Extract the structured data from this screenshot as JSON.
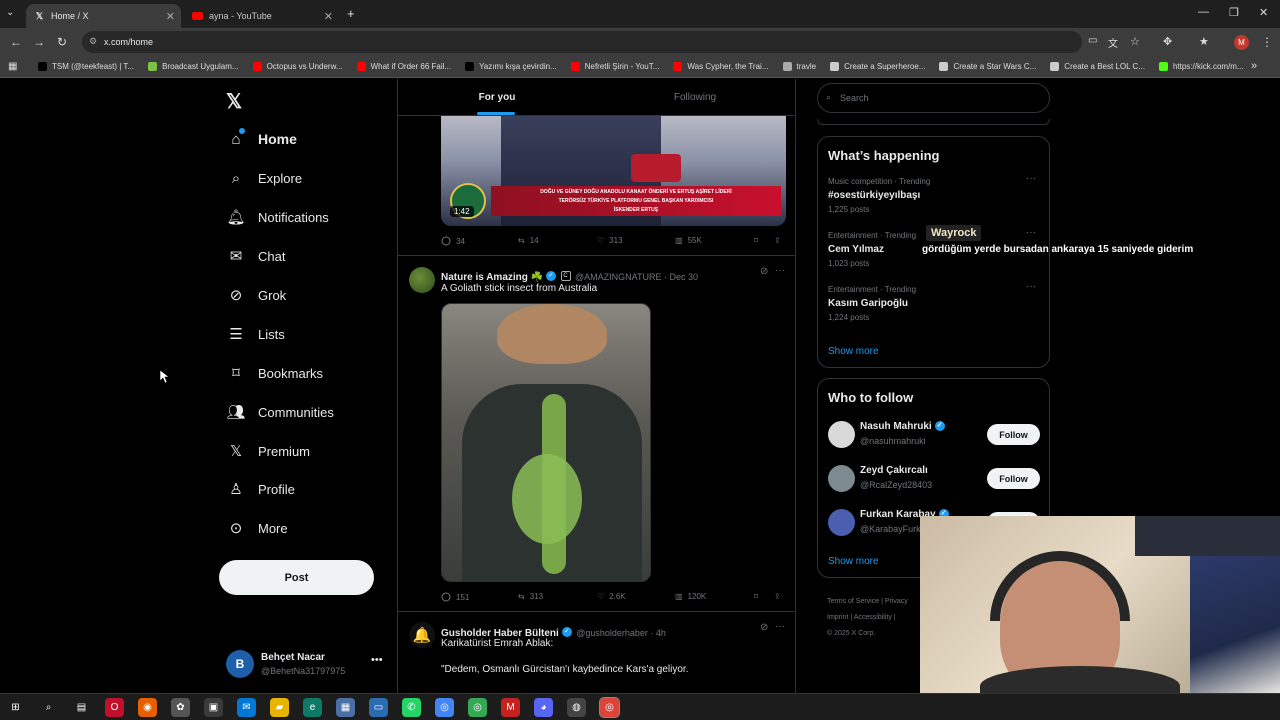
{
  "browser": {
    "tabs": [
      {
        "title": "Home / X",
        "favicon": "x-logo-icon"
      },
      {
        "title": "ayna - YouTube",
        "favicon": "youtube-icon"
      }
    ],
    "url": "x.com/home",
    "bookmarks": [
      {
        "label": "TSM (@teekfeast) | T...",
        "icon": "tiktok-icon",
        "color": "#000000"
      },
      {
        "label": "Broadcast Uygulam...",
        "icon": "leaf-icon",
        "color": "#7cc242"
      },
      {
        "label": "Octopus vs Underw...",
        "icon": "youtube-icon",
        "color": "#ff0000"
      },
      {
        "label": "What if Order 66 Fail...",
        "icon": "youtube-icon",
        "color": "#ff0000"
      },
      {
        "label": "Yazımı kışa çevirdin...",
        "icon": "tiktok-icon",
        "color": "#000000"
      },
      {
        "label": "Nefretli Şirin - YouT...",
        "icon": "youtube-icon",
        "color": "#ff0000"
      },
      {
        "label": "Was Cypher, the Trai...",
        "icon": "youtube-icon",
        "color": "#ff0000"
      },
      {
        "label": "travle",
        "icon": "compass-icon",
        "color": "#aaaaaa"
      },
      {
        "label": "Create a Superheroe...",
        "icon": "doc-icon",
        "color": "#cccccc"
      },
      {
        "label": "Create a Star Wars C...",
        "icon": "doc-icon",
        "color": "#cccccc"
      },
      {
        "label": "Create a Best LOL C...",
        "icon": "doc-icon",
        "color": "#cccccc"
      },
      {
        "label": "https://kick.com/m...",
        "icon": "kick-icon",
        "color": "#53fc18"
      }
    ],
    "profile_initial": "M"
  },
  "sidebar": {
    "items": [
      {
        "label": "Home",
        "icon": "home-icon"
      },
      {
        "label": "Explore",
        "icon": "search-icon"
      },
      {
        "label": "Notifications",
        "icon": "bell-icon"
      },
      {
        "label": "Chat",
        "icon": "mail-icon"
      },
      {
        "label": "Grok",
        "icon": "grok-icon"
      },
      {
        "label": "Lists",
        "icon": "list-icon"
      },
      {
        "label": "Bookmarks",
        "icon": "bookmark-icon"
      },
      {
        "label": "Communities",
        "icon": "people-icon"
      },
      {
        "label": "Premium",
        "icon": "x-logo-icon"
      },
      {
        "label": "Profile",
        "icon": "person-icon"
      },
      {
        "label": "More",
        "icon": "more-circle-icon"
      }
    ],
    "post_label": "Post",
    "account": {
      "initial": "B",
      "name": "Behçet Nacar",
      "handle": "@BehetNa31797975"
    }
  },
  "feed": {
    "tabs": [
      "For you",
      "Following"
    ],
    "video_post": {
      "video_duration": "1:42",
      "banner_line1": "DOĞU VE GÜNEY DOĞU ANADOLU KANAAT ÖNDERİ VE ERTUŞ AŞİRET LİDERİ",
      "banner_line2": "TERÖRSÜZ TÜRKİYE PLATFORMU GENEL BAŞKAN YARDIMCISI",
      "banner_line3": "İSKENDER ERTUŞ",
      "stats": {
        "replies": "34",
        "reposts": "14",
        "likes": "313",
        "views": "55K"
      }
    },
    "post2": {
      "name": "Nature is Amazing ☘️",
      "handle": "@AMAZINGNATURE · Dec 30",
      "text": "A Goliath stick insect from Australia",
      "stats": {
        "replies": "151",
        "reposts": "313",
        "likes": "2.6K",
        "views": "120K"
      }
    },
    "post3": {
      "name": "Gusholder Haber Bülteni",
      "handle": "@gusholderhaber · 4h",
      "line1": "Karikatürist Emrah Ablak:",
      "line2": "\"Dedem, Osmanlı Gürcistan'ı kaybedince Kars'a geliyor."
    }
  },
  "right": {
    "search_placeholder": "Search",
    "happening": {
      "title": "What’s happening",
      "trends": [
        {
          "category": "Music competition · Trending",
          "name": "#osestürkiyeyılbaşı",
          "posts": "1,225 posts"
        },
        {
          "category": "Entertainment · Trending",
          "name": "Cem Yılmaz",
          "posts": "1,023 posts"
        },
        {
          "category": "Entertainment · Trending",
          "name": "Kasım Garipoğlu",
          "posts": "1,224 posts"
        }
      ],
      "show_more": "Show more"
    },
    "who_to_follow": {
      "title": "Who to follow",
      "users": [
        {
          "name": "Nasuh Mahruki",
          "handle": "@nasuhmahruki",
          "verified": true
        },
        {
          "name": "Zeyd Çakırcalı",
          "handle": "@RcalZeyd28403",
          "verified": false
        },
        {
          "name": "Furkan Karabay",
          "handle": "@KarabayFurk",
          "verified": true
        }
      ],
      "follow_label": "Follow",
      "show_more": "Show more"
    },
    "footer": {
      "line1": "Terms of Service  |  Privacy",
      "line2": "Imprint  |  Accessibility  |",
      "line3": "© 2025 X Corp."
    }
  },
  "overlay": {
    "chat_user": "Wayrock",
    "chat_message": "gördüğüm yerde bursadan ankaraya 15 saniyede giderim"
  },
  "colors": {
    "accent": "#1d9bf0",
    "background": "#000000",
    "border": "#2f3336",
    "muted": "#71767b"
  }
}
